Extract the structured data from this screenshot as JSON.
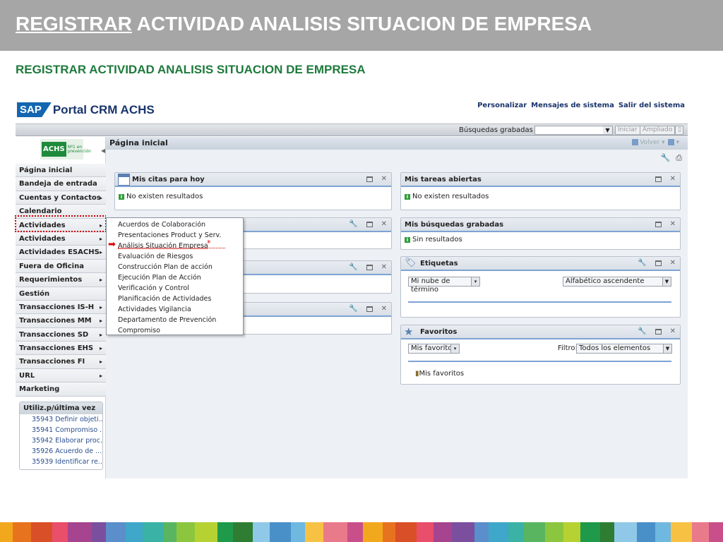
{
  "slide": {
    "title_underlined": "REGISTRAR",
    "title_rest": " ACTIVIDAD ANALISIS SITUACION DE EMPRESA",
    "subtitle": "REGISTRAR ACTIVIDAD ANALISIS SITUACION DE EMPRESA"
  },
  "portal": {
    "sap_badge": "SAP",
    "name": "Portal CRM ACHS",
    "top_links": [
      "Personalizar",
      "Mensajes de sistema",
      "Salir del sistema"
    ]
  },
  "toolbar": {
    "saved_searches": "Búsquedas grabadas ▾",
    "search_value": "",
    "start_button": "Iniciar",
    "extended_button": "Ampliado"
  },
  "logo": {
    "text": "ACHS",
    "tagline": "Nº1 en prevención"
  },
  "nav": {
    "items": [
      {
        "label": "Página inicial",
        "arrow": ""
      },
      {
        "label": "Bandeja de entrada",
        "arrow": ""
      },
      {
        "label": "Cuentas y Contactos",
        "arrow": "▸"
      },
      {
        "label": "Calendario",
        "arrow": ""
      },
      {
        "label": "Actividades Prevenc...",
        "arrow": "▸"
      },
      {
        "label": "Actividades Comercial",
        "arrow": "▸"
      },
      {
        "label": "Actividades ESACHS",
        "arrow": "▸"
      },
      {
        "label": "Fuera de Oficina",
        "arrow": ""
      },
      {
        "label": "Requerimientos",
        "arrow": "▸"
      },
      {
        "label": "Gestión Conocimiento",
        "arrow": ""
      },
      {
        "label": "Transacciones IS-H",
        "arrow": "▸"
      },
      {
        "label": "Transacciones MM",
        "arrow": "▸"
      },
      {
        "label": "Transacciones SD",
        "arrow": "▸"
      },
      {
        "label": "Transacciones EHS",
        "arrow": "▸"
      },
      {
        "label": "Transacciones FI",
        "arrow": "▸"
      },
      {
        "label": "URL",
        "arrow": "▸"
      },
      {
        "label": "Marketing",
        "arrow": ""
      }
    ]
  },
  "recent": {
    "title": "Utiliz.p/última vez",
    "items": [
      "35943 Definir objeti...",
      "35941 Compromiso ...",
      "35942 Elaborar proc...",
      "35926 Acuerdo de ...",
      "35939 Identificar re..."
    ]
  },
  "main": {
    "page_title": "Página inicial",
    "back_label": "Volver"
  },
  "panels": {
    "citas": {
      "title": "Mis citas para hoy",
      "msg": "No existen resultados"
    },
    "tareas": {
      "title": "Mis tareas abiertas",
      "msg": "No existen resultados"
    },
    "busquedas": {
      "title": "Mis búsquedas grabadas",
      "msg": "Sin resultados"
    },
    "etiquetas": {
      "title": "Etiquetas",
      "cloud_select": "Mi nube de término",
      "sort_select": "Alfabético ascendente"
    },
    "favoritos": {
      "title": "Favoritos",
      "fav_select": "Mis favoritos",
      "filter_label": "Filtro:",
      "filter_select": "Todos los elementos",
      "list_item": "Mis favoritos"
    }
  },
  "menu": {
    "items": [
      "Acuerdos de Colaboración",
      "Presentaciones Product y Serv.",
      "Análisis Situación Empresa",
      "Evaluación de Riesgos",
      "Construcción Plan de acción",
      "Ejecución Plan de Acción",
      "Verificación y Control",
      "Planificación de Actividades",
      "Actividades Vigilancia",
      "Departamento de Prevención",
      "Compromiso"
    ],
    "marker": "*"
  },
  "footer_colors": [
    "#f2a81d",
    "#e8731e",
    "#d94f27",
    "#e94e6b",
    "#a6448f",
    "#7b4f9d",
    "#5a8fcb",
    "#3fa7c9",
    "#3ab2a6",
    "#59b560",
    "#8cc63f",
    "#b6d232",
    "#1e9a4a",
    "#2e7d32",
    "#90c8e8",
    "#4a90c8",
    "#6fb8e0",
    "#f7c243",
    "#e87a8a",
    "#c94f8b"
  ]
}
